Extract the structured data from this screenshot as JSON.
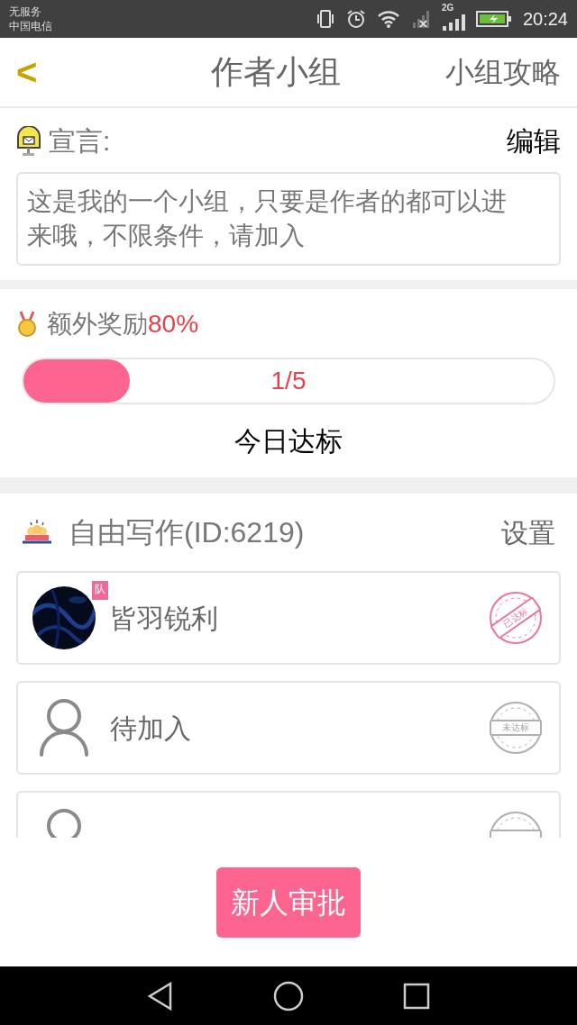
{
  "status_bar": {
    "carrier_top": "无服务",
    "carrier_bottom": "中国电信",
    "network": "2G",
    "time": "20:24"
  },
  "header": {
    "back": "<",
    "title": "作者小组",
    "action": "小组攻略"
  },
  "manifesto": {
    "label": "宣言:",
    "edit": "编辑",
    "text": "这是我的一个小组，只要是作者的都可以进来哦，不限条件，请加入"
  },
  "bonus": {
    "label": "额外奖励",
    "value": "80%",
    "level": 0.2,
    "reading": "1/5",
    "caption": "今日达标"
  },
  "group": {
    "title": "自由写作(ID:6219)",
    "settings": "设置",
    "members": [
      {
        "kind": "member",
        "name": "皆羽锐利",
        "badge": "队",
        "reached": true,
        "stamp": "已达标"
      },
      {
        "kind": "empty",
        "name": "待加入",
        "reached": false,
        "stamp": "未达标"
      },
      {
        "kind": "empty",
        "reached": false
      }
    ]
  },
  "approve_button": "新人审批"
}
